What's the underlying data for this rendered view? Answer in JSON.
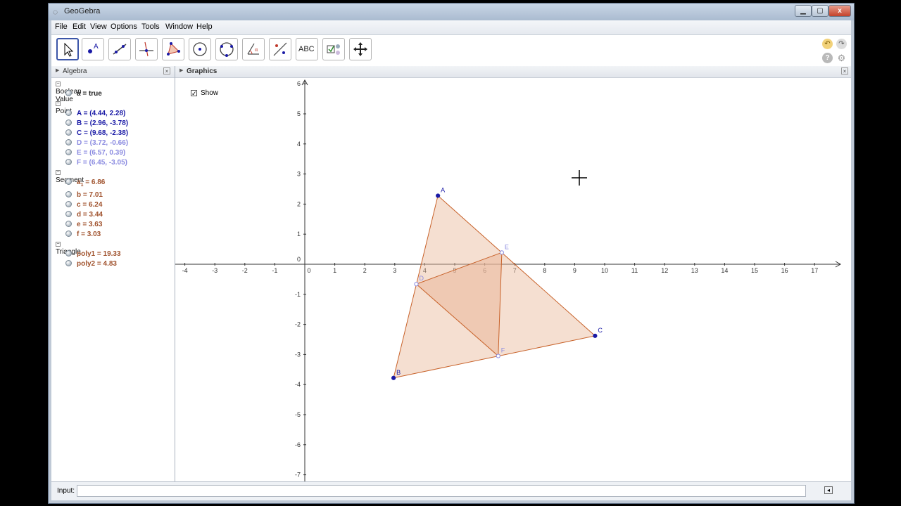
{
  "window": {
    "title": "GeoGebra"
  },
  "menu": [
    "File",
    "Edit",
    "View",
    "Options",
    "Tools",
    "Window",
    "Help"
  ],
  "toolbar": {
    "text_tool_label": "ABC"
  },
  "algebra": {
    "title": "Algebra",
    "groups": [
      {
        "label": "Boolean Value",
        "items": [
          {
            "text": "a = true",
            "color": "#222222"
          }
        ]
      },
      {
        "label": "Point",
        "items": [
          {
            "text": "A = (4.44, 2.28)",
            "color": "#1a1aa6"
          },
          {
            "text": "B = (2.96, -3.78)",
            "color": "#1a1aa6"
          },
          {
            "text": "C = (9.68, -2.38)",
            "color": "#1a1aa6"
          },
          {
            "text": "D = (3.72, -0.66)",
            "color": "#8a8ae0"
          },
          {
            "text": "E = (6.57, 0.39)",
            "color": "#8a8ae0"
          },
          {
            "text": "F = (6.45, -3.05)",
            "color": "#8a8ae0"
          }
        ]
      },
      {
        "label": "Segment",
        "items": [
          {
            "name": "a",
            "sub": "1",
            "rest": " = 6.86",
            "color": "#a0522d"
          },
          {
            "text": "b = 7.01",
            "color": "#a0522d"
          },
          {
            "text": "c = 6.24",
            "color": "#a0522d"
          },
          {
            "text": "d = 3.44",
            "color": "#a0522d"
          },
          {
            "text": "e = 3.63",
            "color": "#a0522d"
          },
          {
            "text": "f = 3.03",
            "color": "#a0522d"
          }
        ]
      },
      {
        "label": "Triangle",
        "items": [
          {
            "text": "poly1 = 19.33",
            "color": "#a0522d"
          },
          {
            "text": "poly2 = 4.83",
            "color": "#a0522d"
          }
        ]
      }
    ]
  },
  "graphics": {
    "title": "Graphics",
    "checkbox": {
      "label": "Show",
      "checked": true
    },
    "x_ticks": [
      -4,
      -3,
      -2,
      -1,
      0,
      1,
      2,
      3,
      4,
      5,
      6,
      7,
      8,
      9,
      10,
      11,
      12,
      13,
      14,
      15,
      16,
      17
    ],
    "y_ticks": [
      6,
      5,
      4,
      3,
      2,
      1,
      0,
      -1,
      -2,
      -3,
      -4,
      -5,
      -6,
      -7
    ],
    "points": [
      {
        "label": "A",
        "x": 4.44,
        "y": 2.28,
        "color": "#1a1aa6"
      },
      {
        "label": "B",
        "x": 2.96,
        "y": -3.78,
        "color": "#1a1aa6"
      },
      {
        "label": "C",
        "x": 9.68,
        "y": -2.38,
        "color": "#1a1aa6"
      },
      {
        "label": "D",
        "x": 3.72,
        "y": -0.66,
        "color": "#8a8ae0"
      },
      {
        "label": "E",
        "x": 6.57,
        "y": 0.39,
        "color": "#8a8ae0"
      },
      {
        "label": "F",
        "x": 6.45,
        "y": -3.05,
        "color": "#8a8ae0"
      }
    ],
    "polygon_color": "#c8622a",
    "polygon_fill": "#e9b79a"
  },
  "inputbar": {
    "label": "Input:",
    "value": ""
  }
}
